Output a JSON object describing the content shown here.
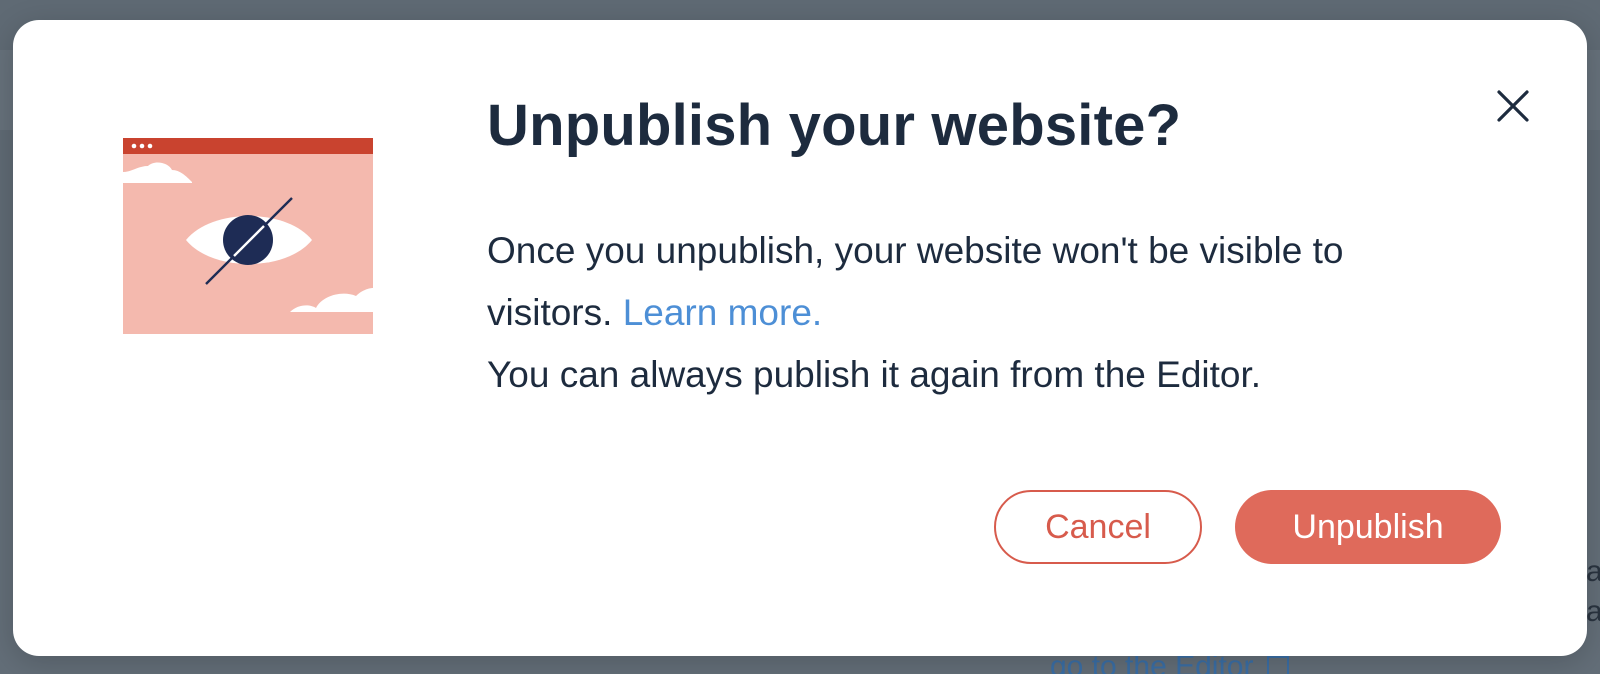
{
  "background": {
    "link_text": "go to the Editor",
    "peek_text_1": "a",
    "peek_text_2": "a"
  },
  "dialog": {
    "title": "Unpublish your website?",
    "body_line1": "Once you unpublish, your website won't be visible to",
    "body_line2_prefix": "visitors.",
    "learn_more": "Learn more.",
    "body_line3": "You can always publish it again from the Editor.",
    "cancel_label": "Cancel",
    "unpublish_label": "Unpublish",
    "close_icon": "close-icon",
    "illustration_icon": "hidden-eye-browser-icon"
  },
  "colors": {
    "primary_danger": "#df6a5b",
    "title_text": "#1d2b3e",
    "link": "#4d8fd6",
    "illustration_bg": "#f4b9ae",
    "illustration_bar": "#c9432f",
    "eye_pupil": "#1e2c55"
  }
}
